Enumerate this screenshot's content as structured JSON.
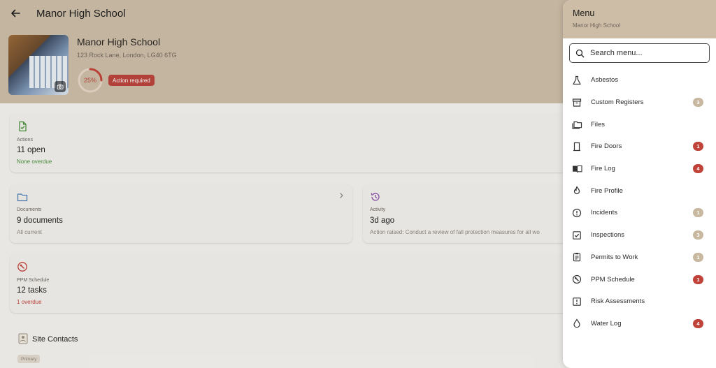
{
  "appbar": {
    "title": "Manor High School"
  },
  "property": {
    "name": "Manor High School",
    "address": "123 Rock Lane, London, LG40 6TG",
    "progress_percent": 25,
    "progress_label": "25%",
    "status_badge": "Action required"
  },
  "cards": {
    "actions": {
      "label": "Actions",
      "value": "11 open",
      "sub": "None overdue"
    },
    "documents": {
      "label": "Documents",
      "value": "9 documents",
      "sub": "All current"
    },
    "activity": {
      "label": "Activity",
      "value": "3d ago",
      "sub": "Action raised: Conduct a review of fall protection measures for all wo"
    },
    "ppm": {
      "label": "PPM Schedule",
      "value": "12 tasks",
      "sub": "1 overdue"
    }
  },
  "contacts": {
    "title": "Site Contacts",
    "chip": "Primary"
  },
  "drawer": {
    "title": "Menu",
    "subtitle": "Manor High School",
    "search_placeholder": "Search menu...",
    "items": [
      {
        "label": "Asbestos",
        "icon": "flask-icon",
        "badge": "",
        "badge_color": ""
      },
      {
        "label": "Custom Registers",
        "icon": "archive-box-icon",
        "badge": "3",
        "badge_color": "#c8b89f"
      },
      {
        "label": "Files",
        "icon": "folders-icon",
        "badge": "",
        "badge_color": ""
      },
      {
        "label": "Fire Doors",
        "icon": "door-icon",
        "badge": "1",
        "badge_color": "#c0433a"
      },
      {
        "label": "Fire Log",
        "icon": "book-icon",
        "badge": "4",
        "badge_color": "#c0433a"
      },
      {
        "label": "Fire Profile",
        "icon": "flame-icon",
        "badge": "",
        "badge_color": ""
      },
      {
        "label": "Incidents",
        "icon": "alert-circle-icon",
        "badge": "1",
        "badge_color": "#c8b89f"
      },
      {
        "label": "Inspections",
        "icon": "checkbox-icon",
        "badge": "3",
        "badge_color": "#c8b89f"
      },
      {
        "label": "Permits to Work",
        "icon": "clipboard-icon",
        "badge": "1",
        "badge_color": "#c8b89f"
      },
      {
        "label": "PPM Schedule",
        "icon": "wrench-circle-icon",
        "badge": "1",
        "badge_color": "#c0433a"
      },
      {
        "label": "Risk Assessments",
        "icon": "alert-square-icon",
        "badge": "",
        "badge_color": ""
      },
      {
        "label": "Water Log",
        "icon": "droplet-icon",
        "badge": "4",
        "badge_color": "#c0433a"
      }
    ]
  }
}
